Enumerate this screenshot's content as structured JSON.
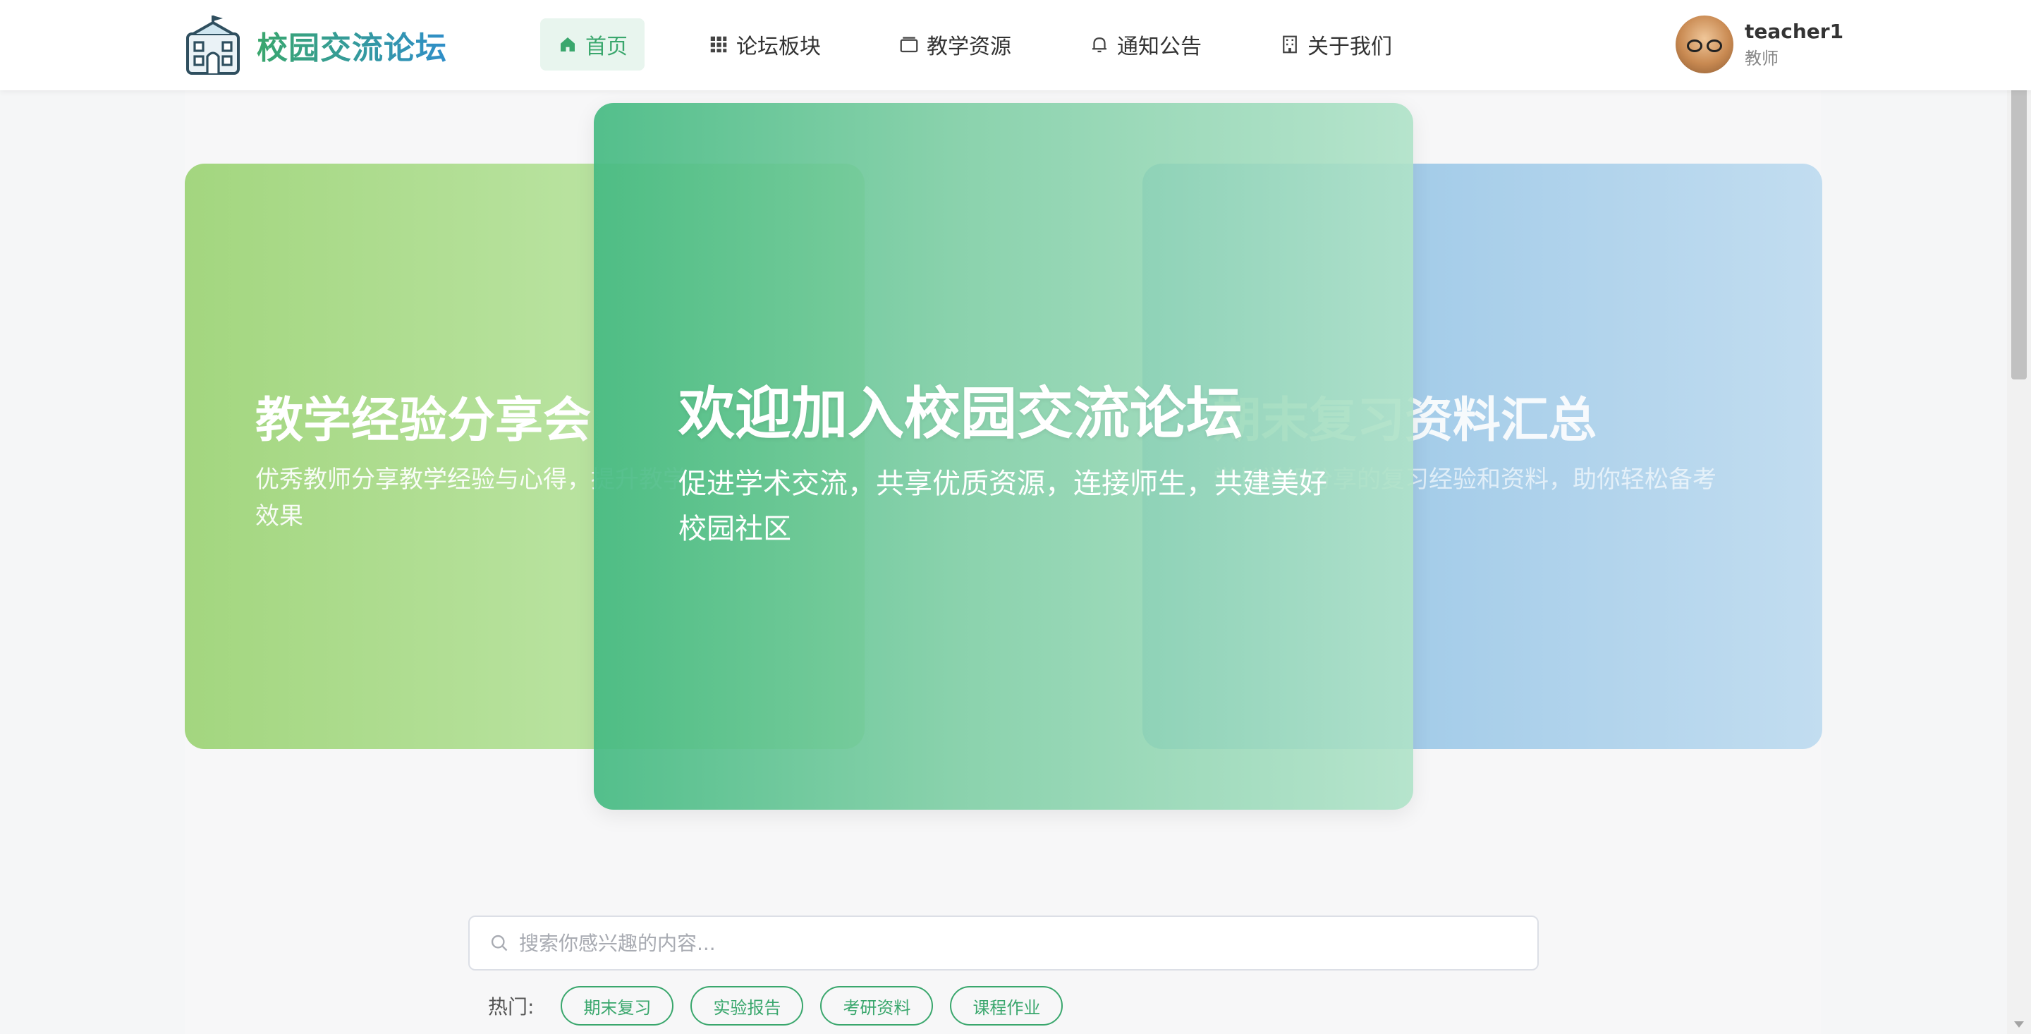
{
  "header": {
    "logo_text": "校园交流论坛",
    "logo_icon": "school-building-icon",
    "nav": [
      {
        "label": "首页",
        "icon": "home-icon",
        "active": true
      },
      {
        "label": "论坛板块",
        "icon": "grid-icon",
        "active": false
      },
      {
        "label": "教学资源",
        "icon": "folder-icon",
        "active": false
      },
      {
        "label": "通知公告",
        "icon": "bell-icon",
        "active": false
      },
      {
        "label": "关于我们",
        "icon": "building-icon",
        "active": false
      }
    ],
    "user": {
      "name": "teacher1",
      "role": "教师"
    }
  },
  "carousel": {
    "slides": [
      {
        "title": "教学经验分享会",
        "desc": "优秀教师分享教学经验与心得，提升教学效果"
      },
      {
        "title": "欢迎加入校园交流论坛",
        "desc": "促进学术交流，共享优质资源，连接师生，共建美好校园社区"
      },
      {
        "title": "期末复习资料汇总",
        "desc": "学长学姐分享的复习经验和资料，助你轻松备考"
      }
    ],
    "active_index": 1
  },
  "search": {
    "placeholder": "搜索你感兴趣的内容...",
    "value": ""
  },
  "hot": {
    "label": "热门:",
    "tags": [
      "期末复习",
      "实验报告",
      "考研资料",
      "课程作业"
    ]
  },
  "colors": {
    "brand_green": "#3aa76d",
    "brand_blue": "#2f8ec9",
    "nav_active_bg": "#e8f5ee"
  }
}
